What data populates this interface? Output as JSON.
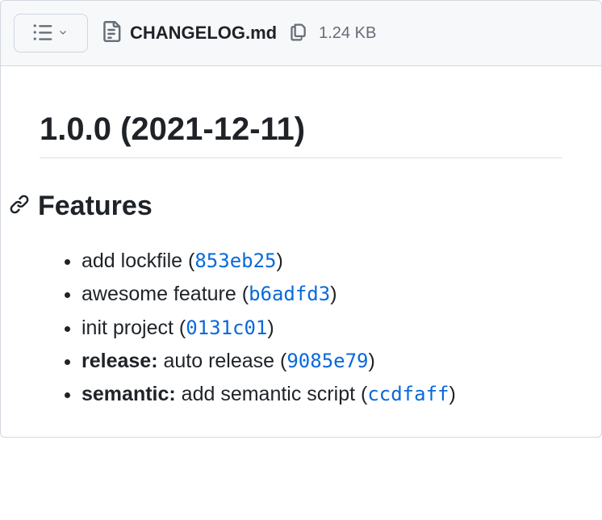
{
  "header": {
    "filename": "CHANGELOG.md",
    "filesize": "1.24 KB"
  },
  "changelog": {
    "version_heading": "1.0.0 (2021-12-11)",
    "section_heading": "Features",
    "features": [
      {
        "prefix": "",
        "text": "add lockfile",
        "commit": "853eb25"
      },
      {
        "prefix": "",
        "text": "awesome feature",
        "commit": "b6adfd3"
      },
      {
        "prefix": "",
        "text": "init project",
        "commit": "0131c01"
      },
      {
        "prefix": "release:",
        "text": "auto release",
        "commit": "9085e79"
      },
      {
        "prefix": "semantic:",
        "text": "add semantic script",
        "commit": "ccdfaff"
      }
    ]
  }
}
